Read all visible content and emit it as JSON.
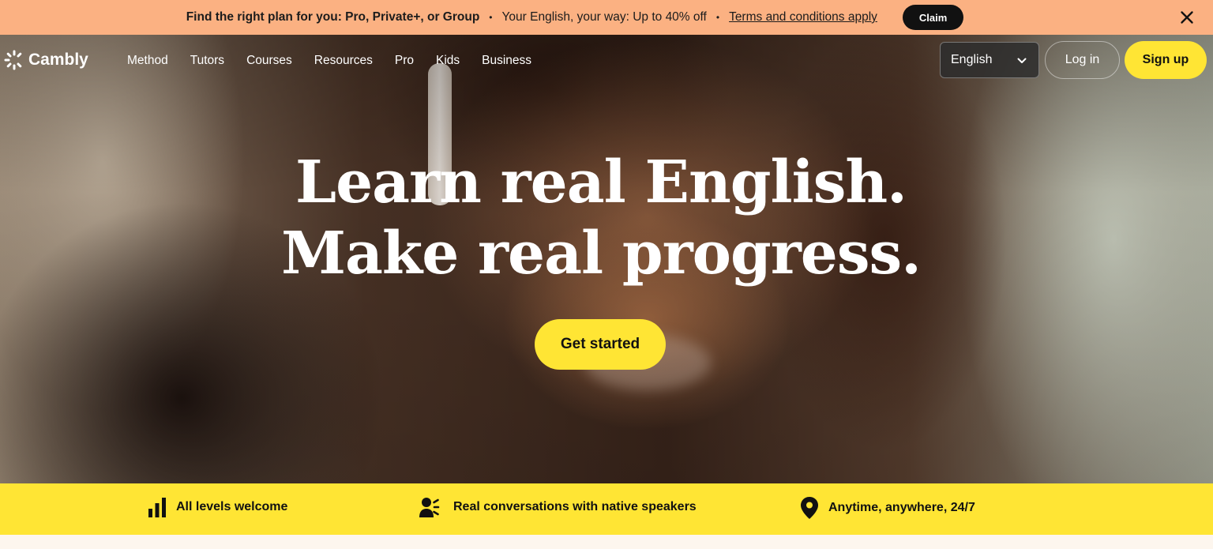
{
  "promo": {
    "headline": "Find the right plan for you: Pro, Private+, or Group",
    "offer": "Your English, your way: Up to 40% off",
    "terms": "Terms and conditions apply",
    "claim": "Claim"
  },
  "nav": {
    "brand": "Cambly",
    "links": [
      "Method",
      "Tutors",
      "Courses",
      "Resources",
      "Pro",
      "Kids",
      "Business"
    ],
    "language": "English",
    "login": "Log in",
    "signup": "Sign up"
  },
  "hero": {
    "line1": "Learn real English.",
    "line2": "Make real progress.",
    "cta": "Get started"
  },
  "features": [
    {
      "icon": "bar-chart-icon",
      "label": "All levels welcome"
    },
    {
      "icon": "speaking-person-icon",
      "label": "Real conversations with native speakers"
    },
    {
      "icon": "map-pin-icon",
      "label": "Anytime, anywhere, 24/7"
    }
  ],
  "colors": {
    "accent": "#ffe534",
    "promo_bg": "#fbb182",
    "dark": "#111111"
  }
}
